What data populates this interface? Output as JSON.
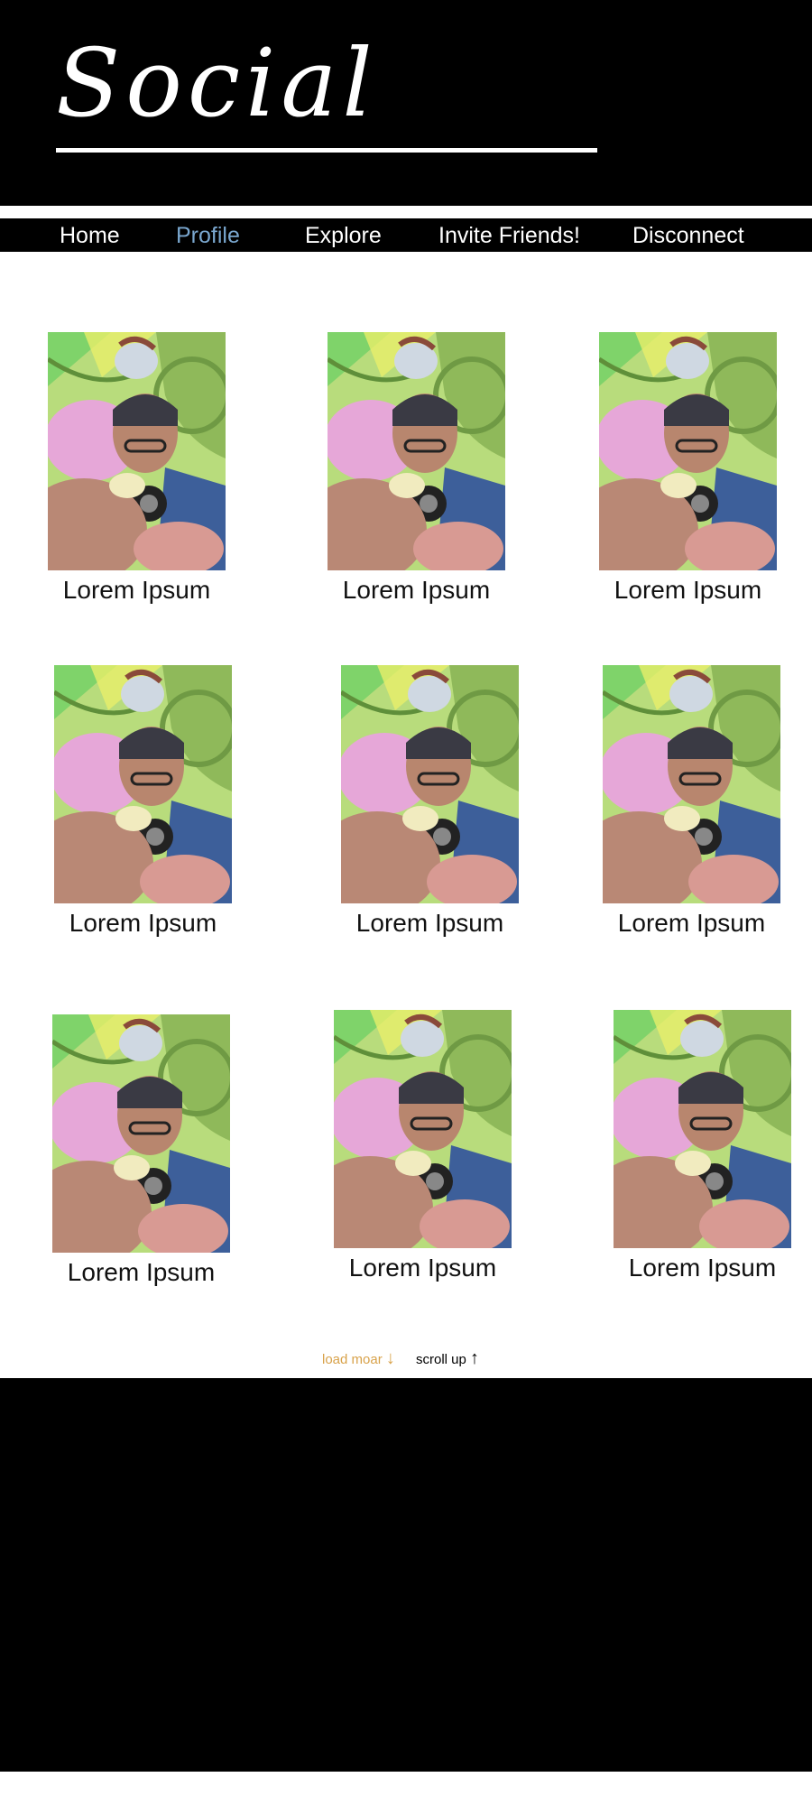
{
  "header": {
    "logo_text": "Social"
  },
  "nav": {
    "items": [
      {
        "label": "Home"
      },
      {
        "label": "Profile"
      },
      {
        "label": "Explore"
      },
      {
        "label": "Invite Friends!"
      },
      {
        "label": "Disconnect"
      }
    ],
    "active": "Profile"
  },
  "grid": {
    "cards": [
      {
        "label": "Lorem Ipsum"
      },
      {
        "label": "Lorem Ipsum"
      },
      {
        "label": "Lorem Ipsum"
      },
      {
        "label": "Lorem Ipsum"
      },
      {
        "label": "Lorem Ipsum"
      },
      {
        "label": "Lorem Ipsum"
      },
      {
        "label": "Lorem Ipsum"
      },
      {
        "label": "Lorem Ipsum"
      },
      {
        "label": "Lorem Ipsum"
      }
    ]
  },
  "footer_links": {
    "load_more": "load moar",
    "load_more_icon": "↓",
    "scroll_up": "scroll up",
    "scroll_up_icon": "↑"
  },
  "colors": {
    "background": "#ffffff",
    "bars": "#000000",
    "nav_active": "#7aa7cf",
    "load_more": "#d8a24a"
  }
}
